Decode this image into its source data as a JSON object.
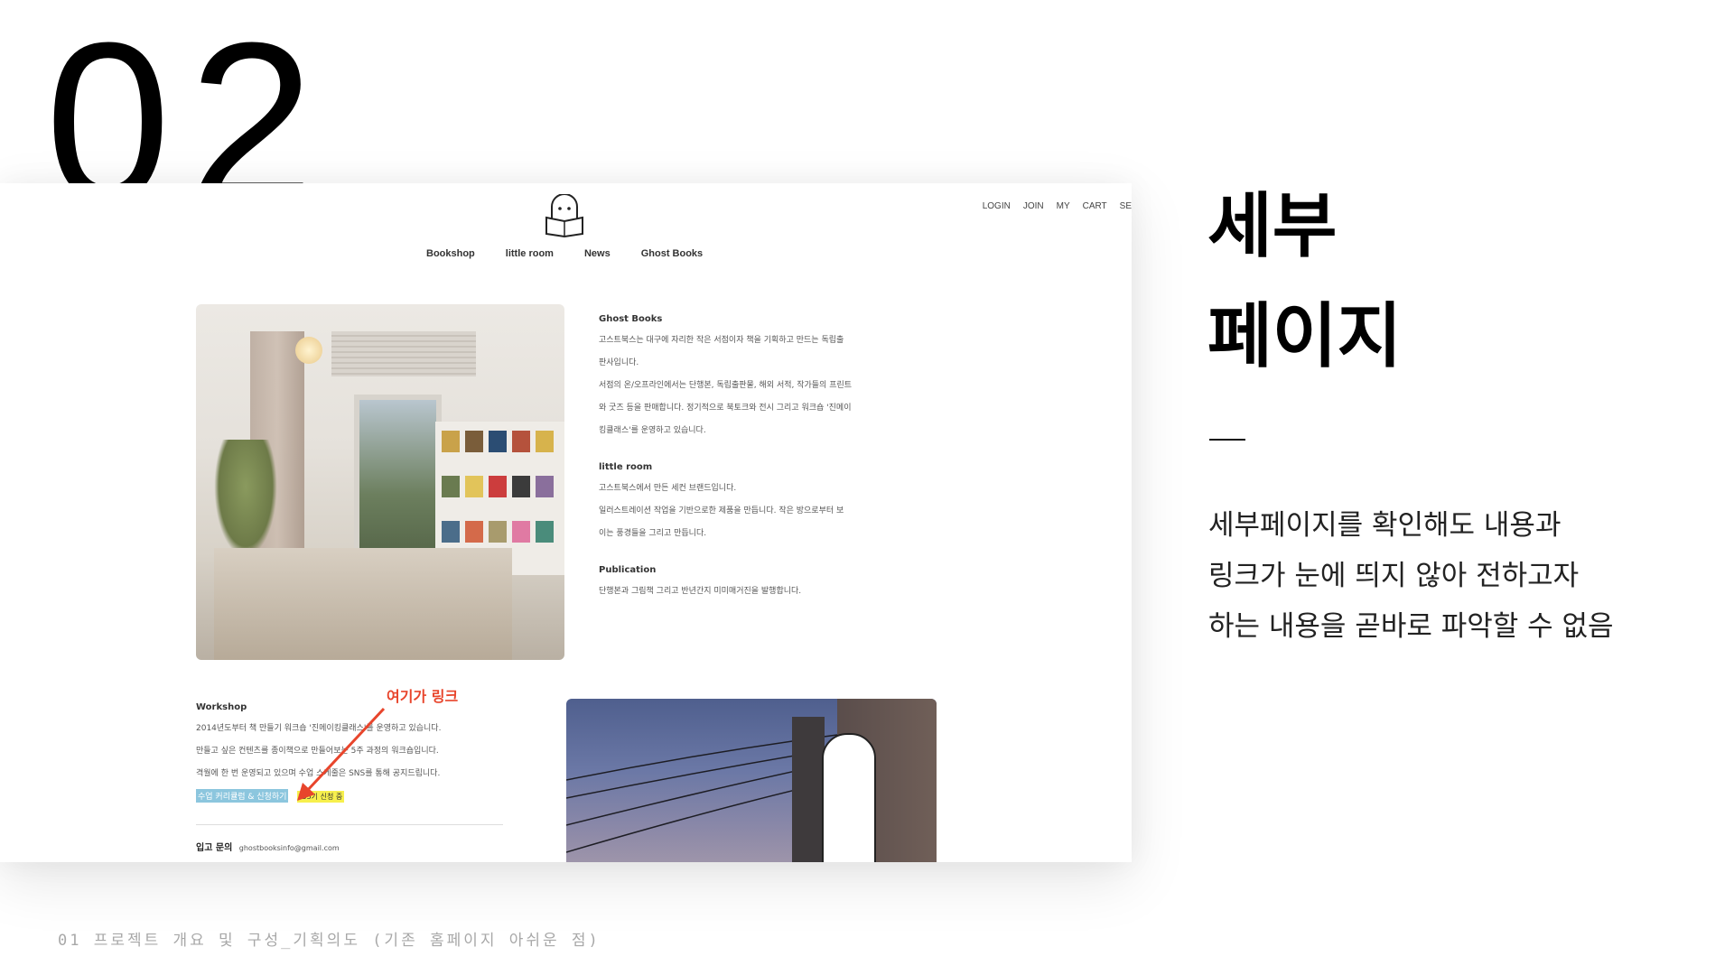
{
  "slide": {
    "number": "02",
    "heading": "세부\n페이지",
    "description_lines": [
      "세부페이지를 확인해도 내용과",
      "링크가 눈에 띄지 않아 전하고자",
      "하는 내용을 곧바로 파악할 수 없음"
    ],
    "footer": "01 프로젝트 개요 및 구성_기획의도 (기존 홈페이지 아쉬운 점)"
  },
  "website": {
    "top_links": [
      "LOGIN",
      "JOIN",
      "MY",
      "CART",
      "SE"
    ],
    "nav": [
      "Bookshop",
      "little room",
      "News",
      "Ghost Books"
    ],
    "sections": [
      {
        "title": "Ghost Books",
        "lines": [
          "고스트북스는 대구에 자리한 작은 서점이자 책을 기획하고 만드는 독립출",
          "판사입니다.",
          "서점의 온/오프라인에서는 단행본, 독립출판물, 해외 서적, 작가들의 프린트",
          "와 굿즈 등을 판매합니다. 정기적으로 북토크와 전시 그리고 워크숍 '진메이",
          "킹클래스'를 운영하고 있습니다."
        ]
      },
      {
        "title": "little room",
        "lines": [
          "고스트북스에서 만든 세컨 브랜드입니다.",
          "일러스트레이션 작업을 기반으로한 제품을 만듭니다. 작은 방으로부터 보",
          "이는 풍경들을 그리고 만듭니다."
        ]
      },
      {
        "title": "Publication",
        "lines": [
          "단행본과 그림책 그리고 반년간지 미미매거진을 발행합니다."
        ]
      }
    ],
    "workshop": {
      "title": "Workshop",
      "lines": [
        "2014년도부터 책 만들기 워크숍 '진메이킹클래스'를 운영하고 있습니다.",
        "만들고 싶은 컨텐츠를 종이책으로 만들어보는 5주 과정의 워크숍입니다.",
        "격월에 한 번 운영되고 있으며 수업 스케줄은 SNS를 통해 공지드립니다."
      ],
      "link_label": "수업 커리큘럼 & 신청하기",
      "badge": "*35기 신청 중"
    },
    "contact_label": "입고 문의",
    "contact_email": "ghostbooksinfo@gmail.com"
  },
  "annotation": {
    "label": "여기가 링크",
    "color": "#e8452c"
  }
}
